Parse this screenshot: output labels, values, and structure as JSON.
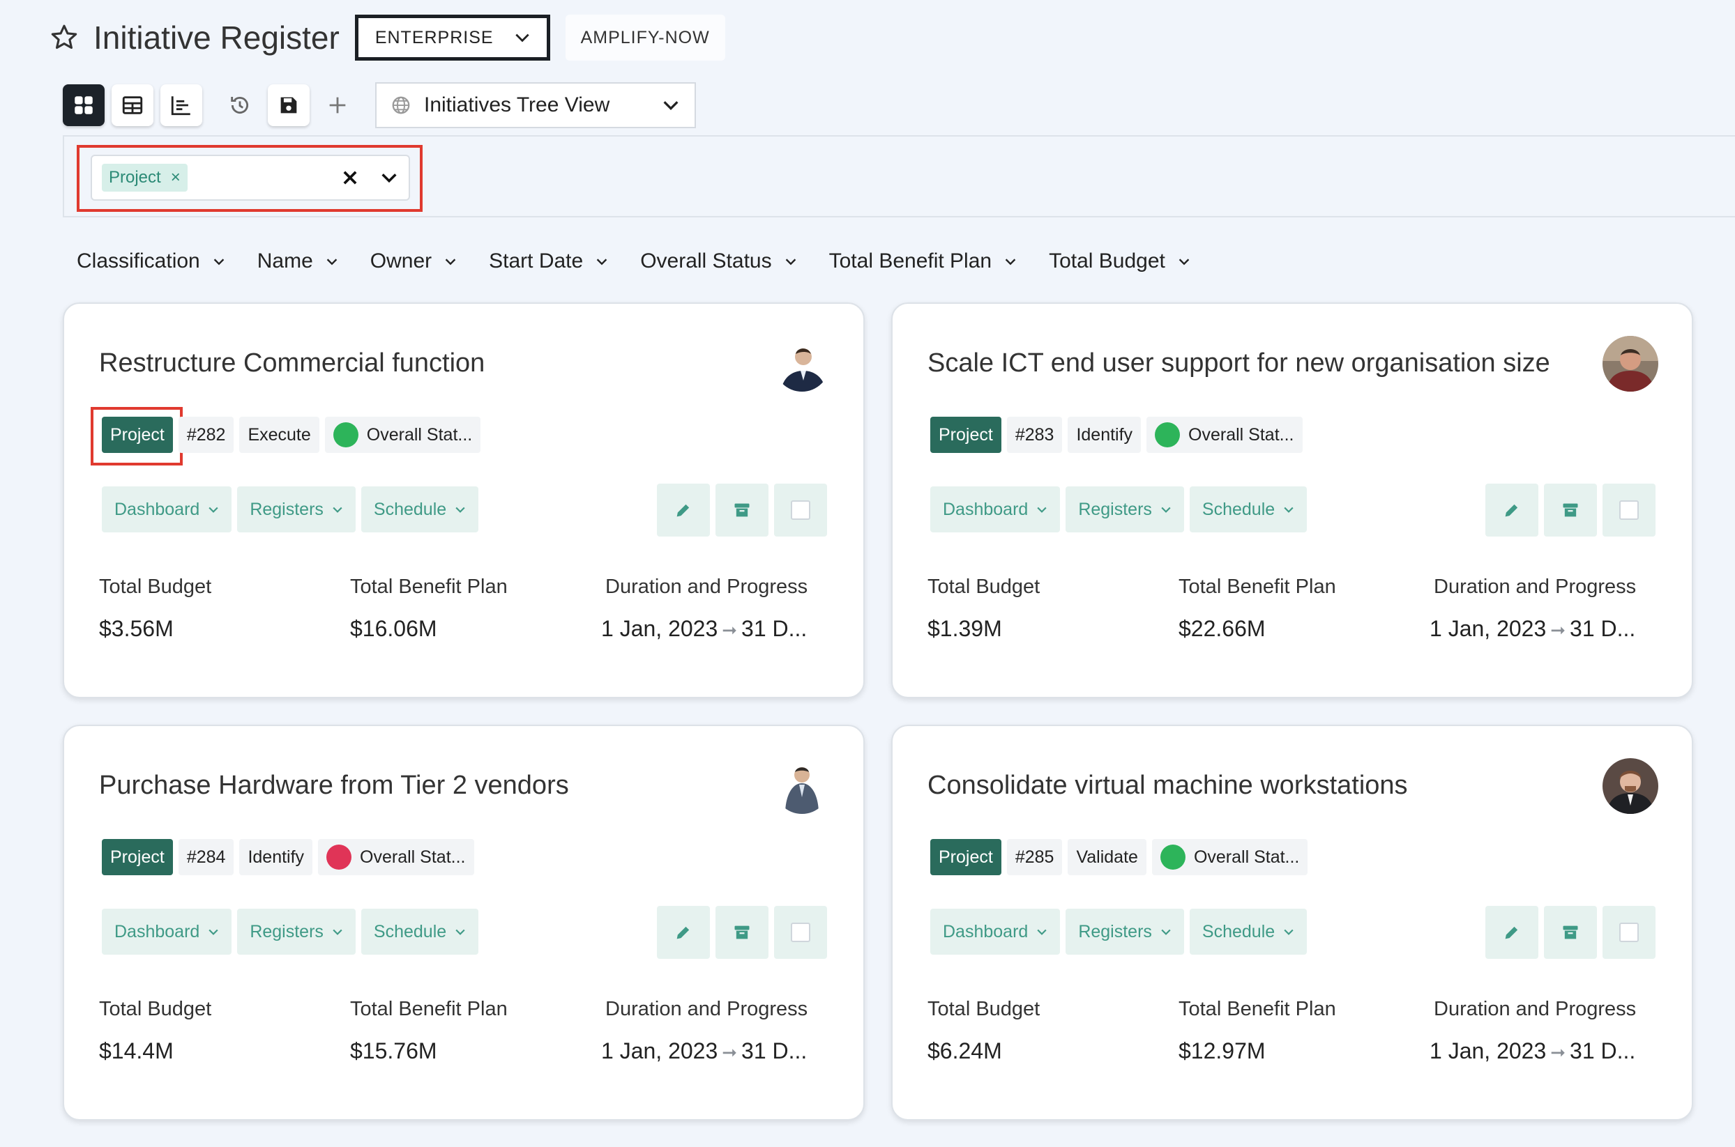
{
  "header": {
    "title": "Initiative Register",
    "workspace_select": "ENTERPRISE",
    "secondary_tab": "AMPLIFY-NOW"
  },
  "toolbar": {
    "view_select": "Initiatives Tree View"
  },
  "filter": {
    "chip_label": "Project",
    "chip_remove": "×"
  },
  "sort_fields": [
    "Classification",
    "Name",
    "Owner",
    "Start Date",
    "Overall Status",
    "Total Benefit Plan",
    "Total Budget"
  ],
  "card_labels": {
    "action_dashboard": "Dashboard",
    "action_registers": "Registers",
    "action_schedule": "Schedule",
    "total_budget": "Total Budget",
    "total_benefit_plan": "Total Benefit Plan",
    "duration_progress": "Duration and Progress",
    "overall_status": "Overall Stat...",
    "arrow": "➞"
  },
  "cards": [
    {
      "title": "Restructure Commercial function",
      "type": "Project",
      "id": "#282",
      "stage": "Execute",
      "status_color": "#2db45a",
      "budget": "$3.56M",
      "benefit": "$16.06M",
      "start": "1 Jan, 2023",
      "end": "31 D..."
    },
    {
      "title": "Scale ICT end user support for new organisation size",
      "type": "Project",
      "id": "#283",
      "stage": "Identify",
      "status_color": "#2db45a",
      "budget": "$1.39M",
      "benefit": "$22.66M",
      "start": "1 Jan, 2023",
      "end": "31 D..."
    },
    {
      "title": "Purchase Hardware from Tier 2 vendors",
      "type": "Project",
      "id": "#284",
      "stage": "Identify",
      "status_color": "#e03457",
      "budget": "$14.4M",
      "benefit": "$15.76M",
      "start": "1 Jan, 2023",
      "end": "31 D..."
    },
    {
      "title": "Consolidate virtual machine workstations",
      "type": "Project",
      "id": "#285",
      "stage": "Validate",
      "status_color": "#2db45a",
      "budget": "$6.24M",
      "benefit": "$12.97M",
      "start": "1 Jan, 2023",
      "end": "31 D..."
    }
  ],
  "colors": {
    "accent": "#2a6b5c",
    "action_bg": "#e6f2ef",
    "highlight": "#e03a2f"
  }
}
